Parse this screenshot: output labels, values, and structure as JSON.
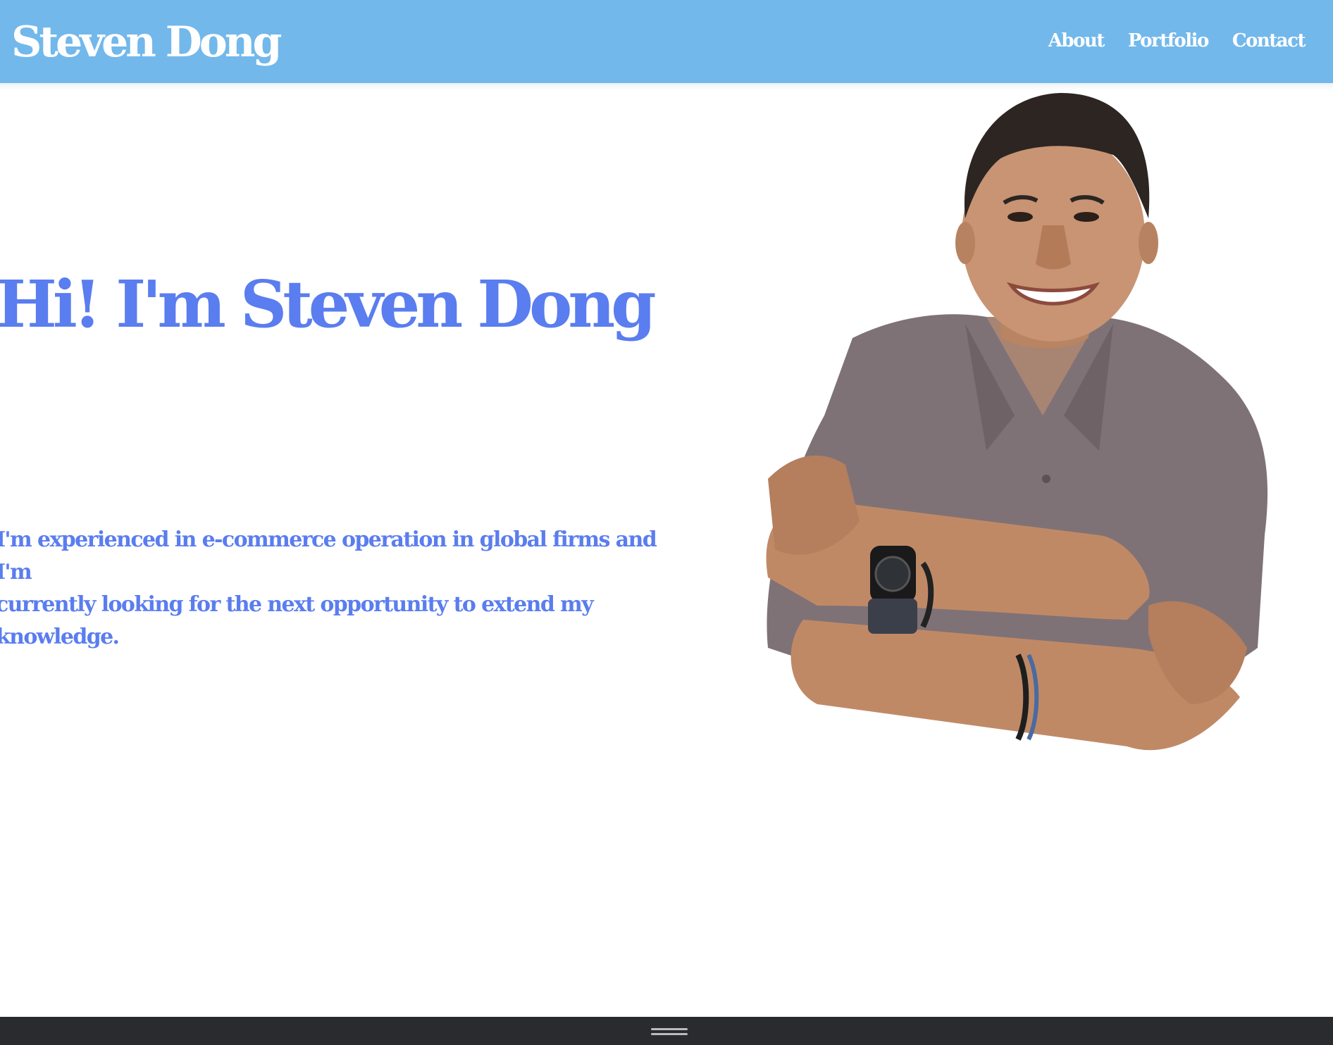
{
  "header": {
    "brand": "Steven Dong",
    "nav": [
      {
        "label": "About"
      },
      {
        "label": "Portfolio"
      },
      {
        "label": "Contact"
      }
    ],
    "background_color": "#72b8eb"
  },
  "hero": {
    "title": "Hi! I'm Steven Dong",
    "description_line1": "I'm experienced in e-commerce operation in global firms and I'm",
    "description_line2": "currently looking for the next opportunity to extend my knowledge.",
    "text_color": "#5a7def",
    "portrait": {
      "subject": "smiling man in grey button-up shirt with arms crossed, wearing a smartwatch and bracelets",
      "icon": "portrait-photo"
    }
  },
  "bottom_bar": {
    "icon": "drag-handle-icon",
    "color": "#292b2e"
  }
}
